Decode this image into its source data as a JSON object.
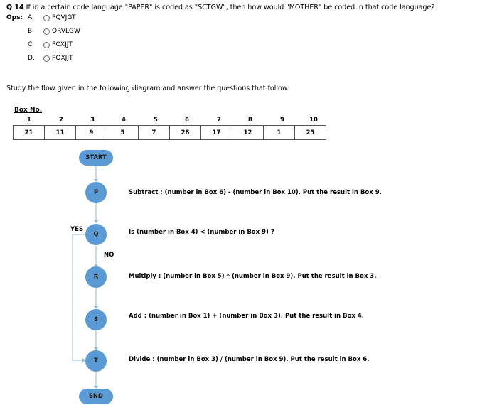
{
  "question": {
    "number": "Q 14",
    "text": "If in a certain code language \"PAPER\" is coded as \"SCTGW\", then how would \"MOTHER\" be coded in that code language?",
    "ops_label": "Ops:",
    "options": [
      {
        "letter": "A.",
        "text": "PQVJGT"
      },
      {
        "letter": "B.",
        "text": "ORVLGW"
      },
      {
        "letter": "C.",
        "text": "POXJJT"
      },
      {
        "letter": "D.",
        "text": "PQXJJT"
      }
    ]
  },
  "instruction": "Study the flow given in the following diagram and answer the questions that follow.",
  "boxes": {
    "heading": "Box No.",
    "numbers": [
      "1",
      "2",
      "3",
      "4",
      "5",
      "6",
      "7",
      "8",
      "9",
      "10"
    ],
    "values": [
      "21",
      "11",
      "9",
      "5",
      "7",
      "28",
      "17",
      "12",
      "1",
      "25"
    ]
  },
  "flowchart": {
    "start": "START",
    "end": "END",
    "yes": "YES",
    "no": "NO",
    "steps": [
      {
        "label": "P",
        "text": "Subtract : (number in Box 6) - (number in Box 10). Put the result in Box 9."
      },
      {
        "label": "Q",
        "text": "Is (number in Box 4) < (number in Box 9) ?"
      },
      {
        "label": "R",
        "text": "Multiply : (number in Box 5) * (number in Box 9). Put the result in Box 3."
      },
      {
        "label": "S",
        "text": "Add : (number in Box 1) + (number in Box 3). Put the result in Box 4."
      },
      {
        "label": "T",
        "text": "Divide : (number in Box 3) / (number in Box 9). Put the result in Box 6."
      }
    ],
    "colors": {
      "node": "#5b9bd5",
      "connector": "#8fb8de"
    }
  }
}
